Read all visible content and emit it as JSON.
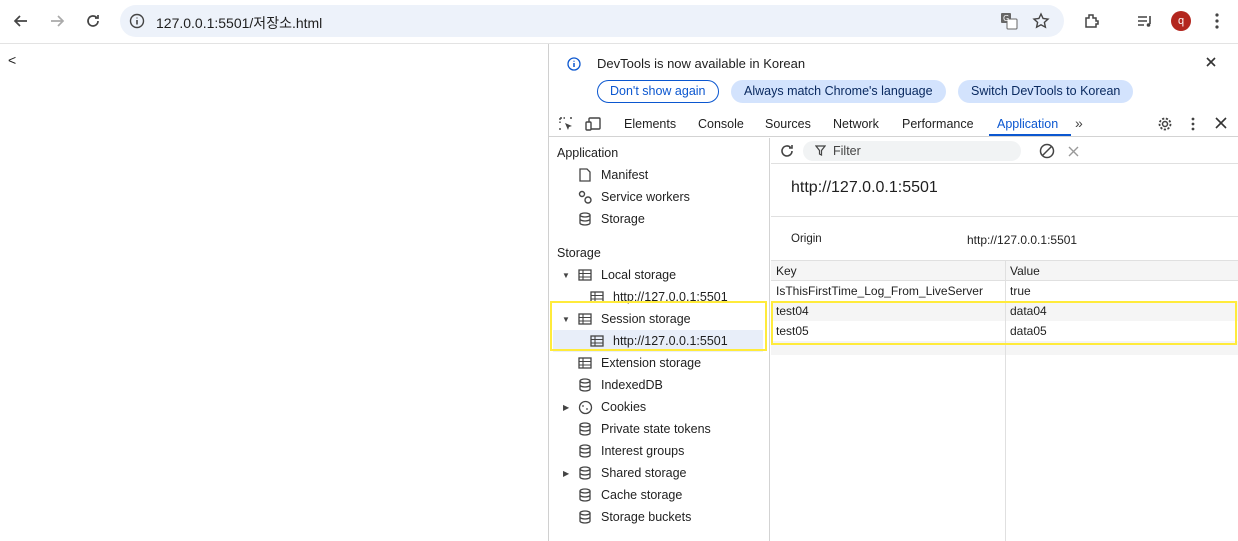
{
  "browser": {
    "url": "127.0.0.1:5501/저장소.html",
    "avatar_letter": "q",
    "accent": "#0b57d0"
  },
  "page": {
    "text": "<"
  },
  "devtools": {
    "infobar": {
      "message": "DevTools is now available in Korean",
      "dont_show": "Don't show again",
      "always_match": "Always match Chrome's language",
      "switch": "Switch DevTools to Korean"
    },
    "tabs": [
      "Elements",
      "Console",
      "Sources",
      "Network",
      "Performance",
      "Application"
    ],
    "active_tab": "Application",
    "sidebar": {
      "application_title": "Application",
      "application_items": [
        "Manifest",
        "Service workers",
        "Storage"
      ],
      "storage_title": "Storage",
      "local_storage": "Local storage",
      "local_origin": "http://127.0.0.1:5501",
      "session_storage": "Session storage",
      "session_origin": "http://127.0.0.1:5501",
      "storage_items": [
        "Extension storage",
        "IndexedDB",
        "Cookies",
        "Private state tokens",
        "Interest groups",
        "Shared storage",
        "Cache storage",
        "Storage buckets"
      ]
    },
    "main": {
      "filter_placeholder": "Filter",
      "origin_title": "http://127.0.0.1:5501",
      "origin_label": "Origin",
      "origin_value": "http://127.0.0.1:5501",
      "columns": [
        "Key",
        "Value"
      ],
      "rows": [
        {
          "key": "IsThisFirstTime_Log_From_LiveServer",
          "value": "true"
        },
        {
          "key": "test04",
          "value": "data04"
        },
        {
          "key": "test05",
          "value": "data05"
        }
      ]
    }
  }
}
